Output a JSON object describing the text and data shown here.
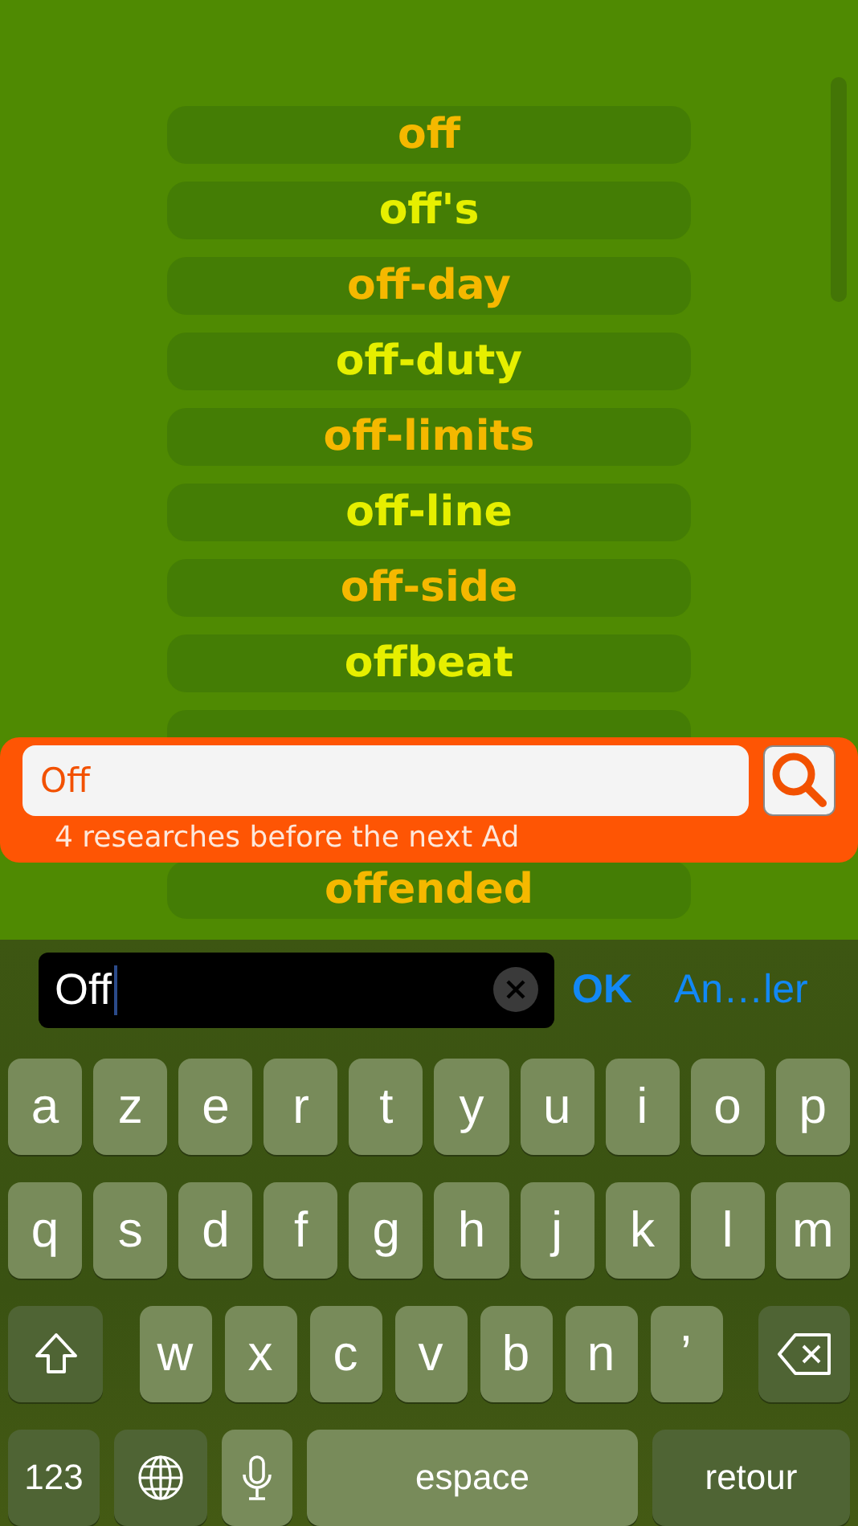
{
  "word_list": [
    {
      "kind": "word",
      "text": "off",
      "color": "#f5b800"
    },
    {
      "kind": "word",
      "text": "off's",
      "color": "#e6ef00"
    },
    {
      "kind": "word",
      "text": "off-day",
      "color": "#f5b800"
    },
    {
      "kind": "word",
      "text": "off-duty",
      "color": "#e6ef00"
    },
    {
      "kind": "word",
      "text": "off-limits",
      "color": "#f5b800"
    },
    {
      "kind": "word",
      "text": "off-line",
      "color": "#e6ef00"
    },
    {
      "kind": "word",
      "text": "off-side",
      "color": "#f5b800"
    },
    {
      "kind": "word",
      "text": "offbeat",
      "color": "#e6ef00"
    },
    {
      "kind": "covered"
    },
    {
      "kind": "word",
      "text": "offended",
      "color": "#f5b800"
    }
  ],
  "search_bar": {
    "value": "Off",
    "notice": "4 researches before the next Ad"
  },
  "input_bar": {
    "value": "Off",
    "ok": "OK",
    "cancel": "An…ler"
  },
  "keyboard": {
    "rows": [
      {
        "keys": [
          {
            "kind": "letter",
            "label": "a"
          },
          {
            "kind": "letter",
            "label": "z"
          },
          {
            "kind": "letter",
            "label": "e"
          },
          {
            "kind": "letter",
            "label": "r"
          },
          {
            "kind": "letter",
            "label": "t"
          },
          {
            "kind": "letter",
            "label": "y"
          },
          {
            "kind": "letter",
            "label": "u"
          },
          {
            "kind": "letter",
            "label": "i"
          },
          {
            "kind": "letter",
            "label": "o"
          },
          {
            "kind": "letter",
            "label": "p"
          }
        ]
      },
      {
        "keys": [
          {
            "kind": "letter",
            "label": "q"
          },
          {
            "kind": "letter",
            "label": "s"
          },
          {
            "kind": "letter",
            "label": "d"
          },
          {
            "kind": "letter",
            "label": "f"
          },
          {
            "kind": "letter",
            "label": "g"
          },
          {
            "kind": "letter",
            "label": "h"
          },
          {
            "kind": "letter",
            "label": "j"
          },
          {
            "kind": "letter",
            "label": "k"
          },
          {
            "kind": "letter",
            "label": "l"
          },
          {
            "kind": "letter",
            "label": "m"
          }
        ]
      },
      {
        "keys": [
          {
            "kind": "shift"
          },
          {
            "kind": "letter",
            "label": "w"
          },
          {
            "kind": "letter",
            "label": "x"
          },
          {
            "kind": "letter",
            "label": "c"
          },
          {
            "kind": "letter",
            "label": "v"
          },
          {
            "kind": "letter",
            "label": "b"
          },
          {
            "kind": "letter",
            "label": "n"
          },
          {
            "kind": "letter",
            "label": "’"
          },
          {
            "kind": "backspace"
          }
        ]
      },
      {
        "keys": [
          {
            "kind": "numbers",
            "label": "123"
          },
          {
            "kind": "globe"
          },
          {
            "kind": "mic"
          },
          {
            "kind": "space",
            "label": "espace"
          },
          {
            "kind": "return",
            "label": "retour"
          }
        ]
      }
    ]
  }
}
